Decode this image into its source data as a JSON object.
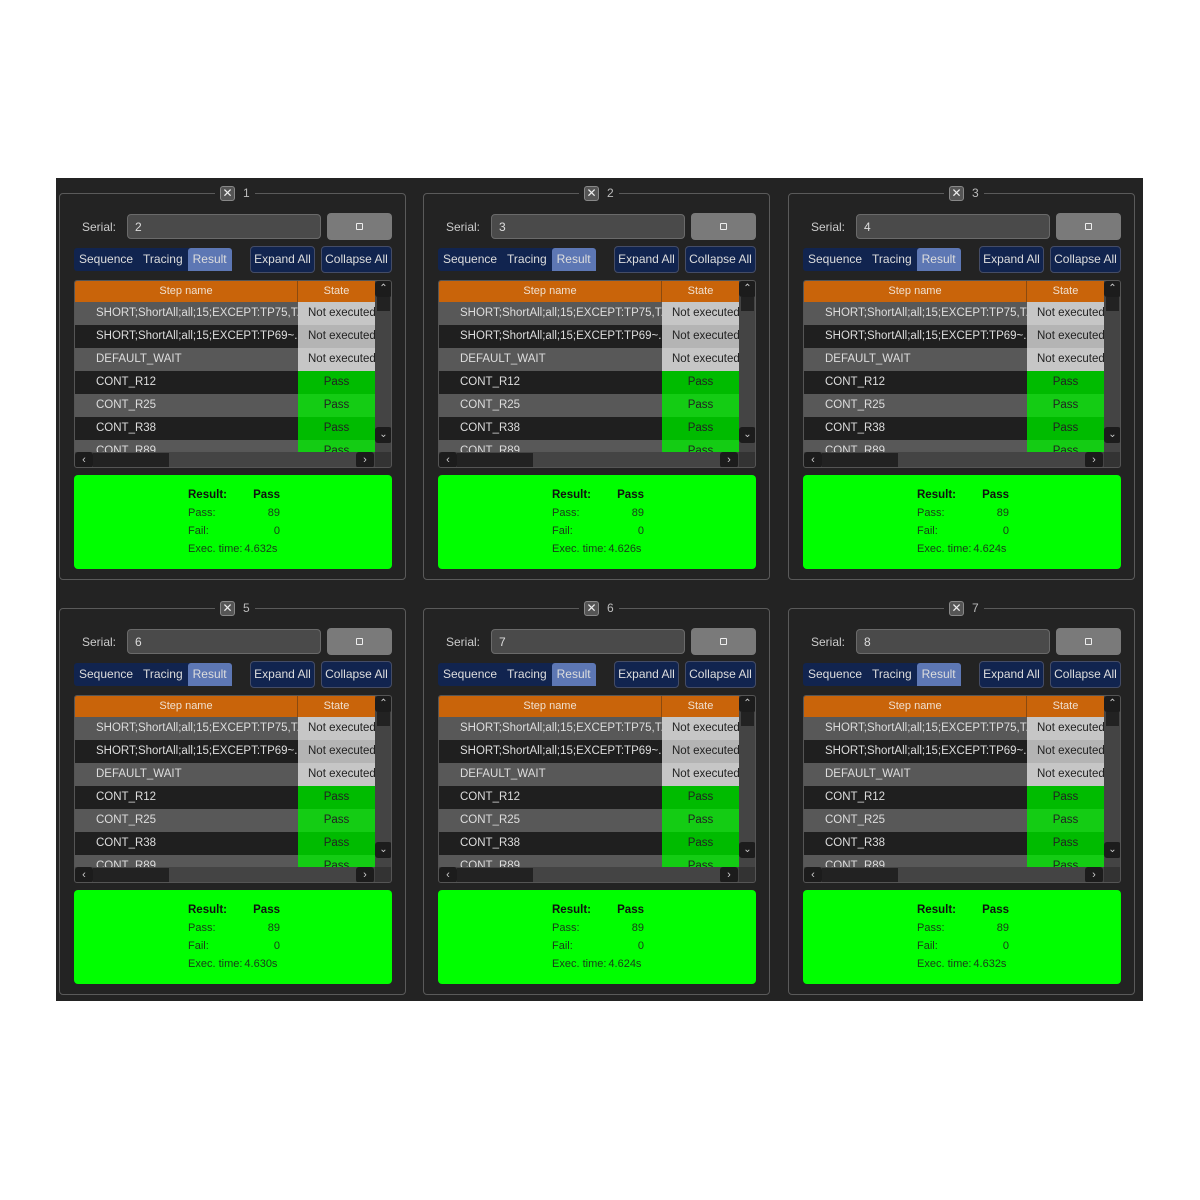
{
  "common": {
    "serial_label": "Serial:",
    "tabs": [
      "Sequence",
      "Tracing",
      "Result"
    ],
    "active_tab": "Result",
    "expand_all": "Expand All",
    "collapse_all": "Collapse All",
    "columns": [
      "Step name",
      "State"
    ],
    "steps": [
      {
        "name": "SHORT;ShortAll;all;15;EXCEPT:TP75,T...",
        "state": "Not executed"
      },
      {
        "name": "SHORT;ShortAll;all;15;EXCEPT:TP69~...",
        "state": "Not executed"
      },
      {
        "name": "DEFAULT_WAIT",
        "state": "Not executed"
      },
      {
        "name": "CONT_R12",
        "state": "Pass"
      },
      {
        "name": "CONT_R25",
        "state": "Pass"
      },
      {
        "name": "CONT_R38",
        "state": "Pass"
      },
      {
        "name": "CONT_R89",
        "state": "Pass"
      }
    ],
    "result_label": "Result:",
    "pass_label": "Pass:",
    "fail_label": "Fail:",
    "exec_label": "Exec. time:"
  },
  "colors": {
    "header": "#c9640a",
    "pass": "#00ff00",
    "tabs": "#11244f"
  },
  "panels": [
    {
      "title": "1",
      "serial": "2",
      "result": "Pass",
      "pass": "89",
      "fail": "0",
      "exec_time": "4.632s"
    },
    {
      "title": "2",
      "serial": "3",
      "result": "Pass",
      "pass": "89",
      "fail": "0",
      "exec_time": "4.626s"
    },
    {
      "title": "3",
      "serial": "4",
      "result": "Pass",
      "pass": "89",
      "fail": "0",
      "exec_time": "4.624s"
    },
    {
      "title": "5",
      "serial": "6",
      "result": "Pass",
      "pass": "89",
      "fail": "0",
      "exec_time": "4.630s"
    },
    {
      "title": "6",
      "serial": "7",
      "result": "Pass",
      "pass": "89",
      "fail": "0",
      "exec_time": "4.624s"
    },
    {
      "title": "7",
      "serial": "8",
      "result": "Pass",
      "pass": "89",
      "fail": "0",
      "exec_time": "4.632s"
    }
  ]
}
